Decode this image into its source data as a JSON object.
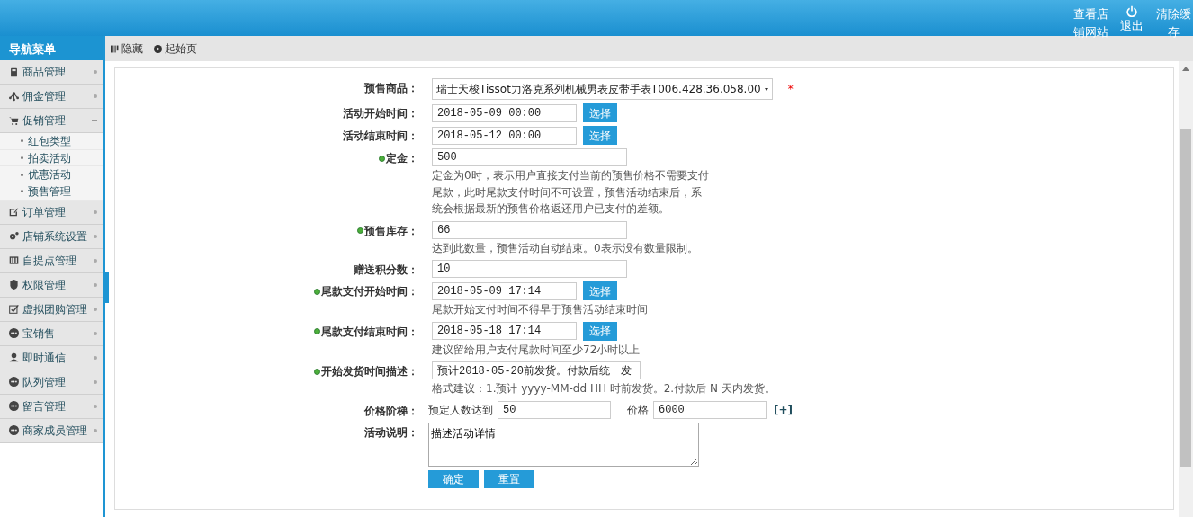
{
  "header_actions": [
    {
      "label": "查看店铺网站"
    },
    {
      "label": "退出"
    },
    {
      "label": "清除缓存"
    }
  ],
  "sidebar": {
    "title": "导航菜单",
    "items": [
      {
        "label": "商品管理",
        "expanded": false
      },
      {
        "label": "佣金管理",
        "expanded": false
      },
      {
        "label": "促销管理",
        "expanded": true,
        "children": [
          {
            "label": "红包类型"
          },
          {
            "label": "拍卖活动"
          },
          {
            "label": "优惠活动"
          },
          {
            "label": "预售管理"
          }
        ]
      },
      {
        "label": "订单管理",
        "expanded": false
      },
      {
        "label": "店铺系统设置",
        "expanded": false
      },
      {
        "label": "自提点管理",
        "expanded": false
      },
      {
        "label": "权限管理",
        "expanded": false
      },
      {
        "label": "虚拟团购管理",
        "expanded": false
      },
      {
        "label": "宝销售",
        "expanded": false
      },
      {
        "label": "即时通信",
        "expanded": false
      },
      {
        "label": "队列管理",
        "expanded": false
      },
      {
        "label": "留言管理",
        "expanded": false
      },
      {
        "label": "商家成员管理",
        "expanded": false
      }
    ]
  },
  "toolbar": [
    {
      "label": "隐藏"
    },
    {
      "label": "起始页"
    }
  ],
  "form": {
    "fields": [
      {
        "label": "预售商品：",
        "kind": "select",
        "required": false,
        "value": "瑞士天梭Tissot力洛克系列机械男表皮带手表T006.428.36.058.00",
        "star": "*"
      },
      {
        "label": "活动开始时间：",
        "kind": "date",
        "required": false,
        "value": "2018-05-09 00:00",
        "button": "选择"
      },
      {
        "label": "活动结束时间：",
        "kind": "date",
        "required": false,
        "value": "2018-05-12 00:00",
        "button": "选择"
      },
      {
        "label": "定金：",
        "kind": "text",
        "required": true,
        "value": "500",
        "hint": "定金为0时，表示用户直接支付当前的预售价格不需要支付尾款，此时尾款支付时间不可设置，预售活动结束后，系统会根据最新的预售价格返还用户已支付的差额。"
      },
      {
        "label": "预售库存：",
        "kind": "text",
        "required": true,
        "value": "66",
        "hint": "达到此数量，预售活动自动结束。0表示没有数量限制。"
      },
      {
        "label": "赠送积分数：",
        "kind": "text",
        "required": false,
        "value": "10"
      },
      {
        "label": "尾款支付开始时间：",
        "kind": "date",
        "required": true,
        "value": "2018-05-09 17:14",
        "button": "选择",
        "hint": "尾款开始支付时间不得早于预售活动结束时间"
      },
      {
        "label": "尾款支付结束时间：",
        "kind": "date",
        "required": true,
        "value": "2018-05-18 17:14",
        "button": "选择",
        "hint": "建议留给用户支付尾款时间至少72小时以上"
      },
      {
        "label": "开始发货时间描述：",
        "kind": "text",
        "required": true,
        "value": "预计2018-05-20前发货。付款后统一发",
        "hint": "格式建议：1.预计 yyyy-MM-dd HH 时前发货。2.付款后 N 天内发货。"
      },
      {
        "label": "价格阶梯：",
        "kind": "tiers",
        "required": false,
        "prefix": "预定人数达到",
        "count": "50",
        "price_label": "价格",
        "price": "6000",
        "add": "[+]"
      },
      {
        "label": "活动说明：",
        "kind": "textarea",
        "required": false,
        "value": "描述活动详情"
      }
    ],
    "buttons": [
      "确定",
      "重置"
    ]
  }
}
